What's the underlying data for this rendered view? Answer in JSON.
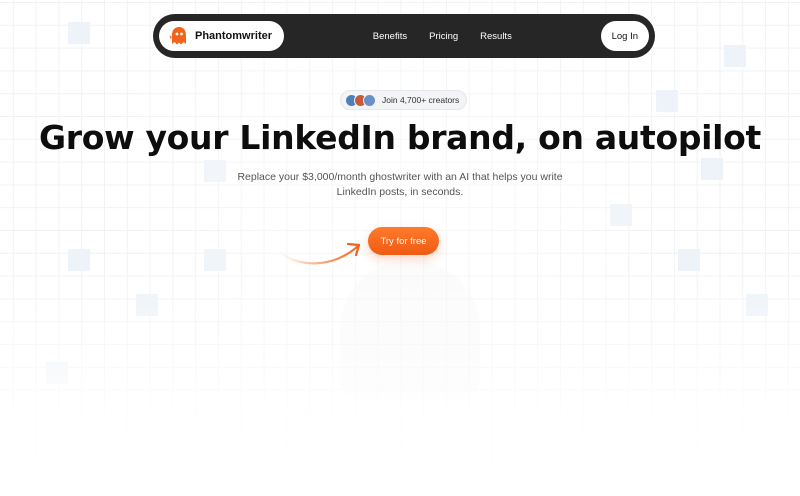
{
  "nav": {
    "brand": "Phantomwriter",
    "links": [
      "Benefits",
      "Pricing",
      "Results"
    ],
    "login_label": "Log In"
  },
  "social_proof": {
    "text": "Join 4,700+ creators"
  },
  "hero": {
    "headline": "Grow your LinkedIn brand, on autopilot",
    "subtitle_line1": "Replace your $3,000/month ghostwriter with an AI that helps you write",
    "subtitle_line2": "LinkedIn posts, in seconds.",
    "cta_label": "Try for free"
  },
  "colors": {
    "accent": "#f26419",
    "nav_bg": "#262626"
  }
}
